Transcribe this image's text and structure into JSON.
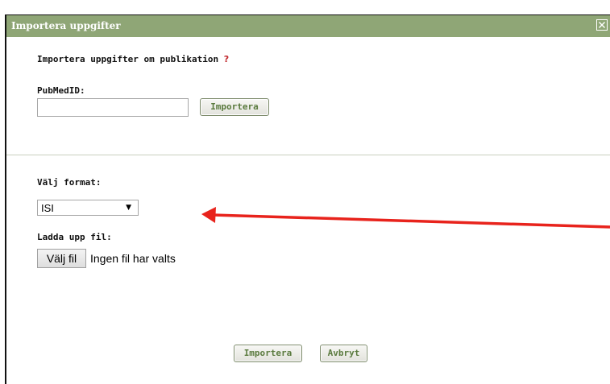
{
  "dialog": {
    "title": "Importera uppgifter",
    "close_icon": "close-box-icon"
  },
  "pubmed_section": {
    "heading": "Importera uppgifter om publikation",
    "help_mark": "?",
    "field_label": "PubMedID:",
    "input_value": "",
    "import_button": "Importera"
  },
  "file_section": {
    "format_label": "Välj format:",
    "format_selected": "ISI",
    "upload_label": "Ladda upp fil:",
    "choose_file_button": "Välj fil",
    "no_file_text": "Ingen fil har valts"
  },
  "footer": {
    "import_button": "Importera",
    "cancel_button": "Avbryt"
  },
  "colors": {
    "titlebar": "#8fa676",
    "button_text": "#5a7a3e",
    "help_mark": "#c0282d",
    "annotation_arrow": "#e8231c"
  }
}
